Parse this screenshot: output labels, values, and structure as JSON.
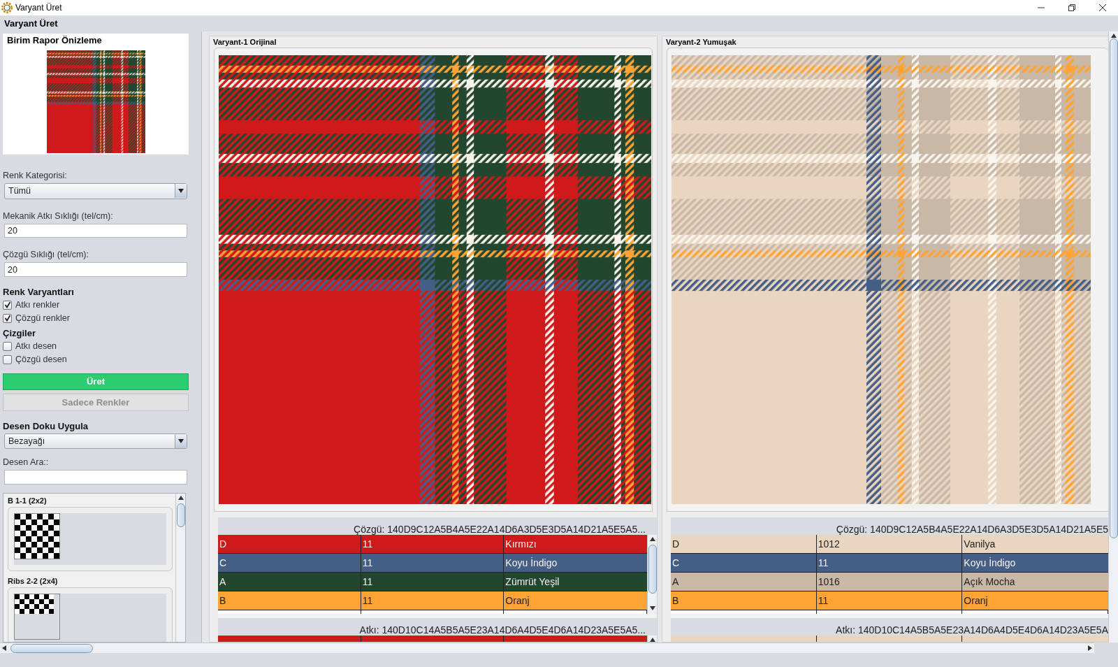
{
  "window": {
    "title": "Varyant Üret"
  },
  "header": "Varyant Üret",
  "preview": {
    "title": "Birim Rapor Önizleme"
  },
  "fields": [
    {
      "kind": "select",
      "label": "Renk Kategorisi:",
      "value": "Tümü"
    },
    {
      "kind": "input",
      "label": "Mekanik Atkı Sıklığı (tel/cm):",
      "value": "20"
    },
    {
      "kind": "input",
      "label": "Çözgü Sıklığı (tel/cm):",
      "value": "20"
    }
  ],
  "color_variants": {
    "title": "Renk Varyantları",
    "options": [
      {
        "label": "Atkı renkler",
        "checked": true
      },
      {
        "label": "Çözgü renkler",
        "checked": true
      }
    ]
  },
  "lines": {
    "title": "Çizgiler",
    "options": [
      {
        "label": "Atkı desen",
        "checked": false
      },
      {
        "label": "Çözgü desen",
        "checked": false
      }
    ]
  },
  "buttons": [
    {
      "label": "Üret",
      "disabled": false
    },
    {
      "label": "Sadece Renkler",
      "disabled": true
    }
  ],
  "texture": {
    "title": "Desen Doku Uygula",
    "value": "Bezayağı",
    "search_label": "Desen Ara::",
    "patterns": [
      {
        "name": "B 1-1 (2x2)",
        "kind": "plain"
      },
      {
        "name": "Ribs 2-2 (2x4)",
        "kind": "rib"
      }
    ]
  },
  "variants": [
    {
      "title": "Varyant-1 Orijinal",
      "warp": {
        "label": "Çözgü: 140D9C12A5B4A5E22A14D6A3D5E3D5A14D21A5E5A5...",
        "rows": [
          {
            "code": "D",
            "count": "11",
            "name": "Kırmızı",
            "color": "#d0191a"
          },
          {
            "code": "C",
            "count": "11",
            "name": "Koyu İndigo",
            "color": "#445e85"
          },
          {
            "code": "A",
            "count": "11",
            "name": "Zümrüt Yeşil",
            "color": "#23462f"
          },
          {
            "code": "B",
            "count": "11",
            "name": "Oranj",
            "color": "#ffa335"
          }
        ]
      },
      "weft": {
        "label": "Atkı: 140D10C14A5B5A5E23A14D6A4D5E4D6A14D23A5E5A5...",
        "rows": [
          {
            "color": "#d0191a"
          }
        ]
      }
    },
    {
      "title": "Varyant-2 Yumuşak",
      "warp": {
        "label": "Çözgü: 140D9C12A5B4A5E22A14D6A3D5E3D5A14D21A5E5",
        "rows": [
          {
            "code": "D",
            "count": "1012",
            "name": "Vanilya",
            "color": "#ead6c0"
          },
          {
            "code": "C",
            "count": "11",
            "name": "Koyu İndigo",
            "color": "#445e85"
          },
          {
            "code": "A",
            "count": "1016",
            "name": "Açık Mocha",
            "color": "#c9b8a6"
          },
          {
            "code": "B",
            "count": "11",
            "name": "Oranj",
            "color": "#ffa335"
          }
        ]
      },
      "weft": {
        "label": "Atkı: 140D10C14A5B5A5E23A14D6A4D5E4D6A14D23A5E5A",
        "rows": [
          {
            "color": "#ead6c0"
          }
        ]
      }
    }
  ]
}
